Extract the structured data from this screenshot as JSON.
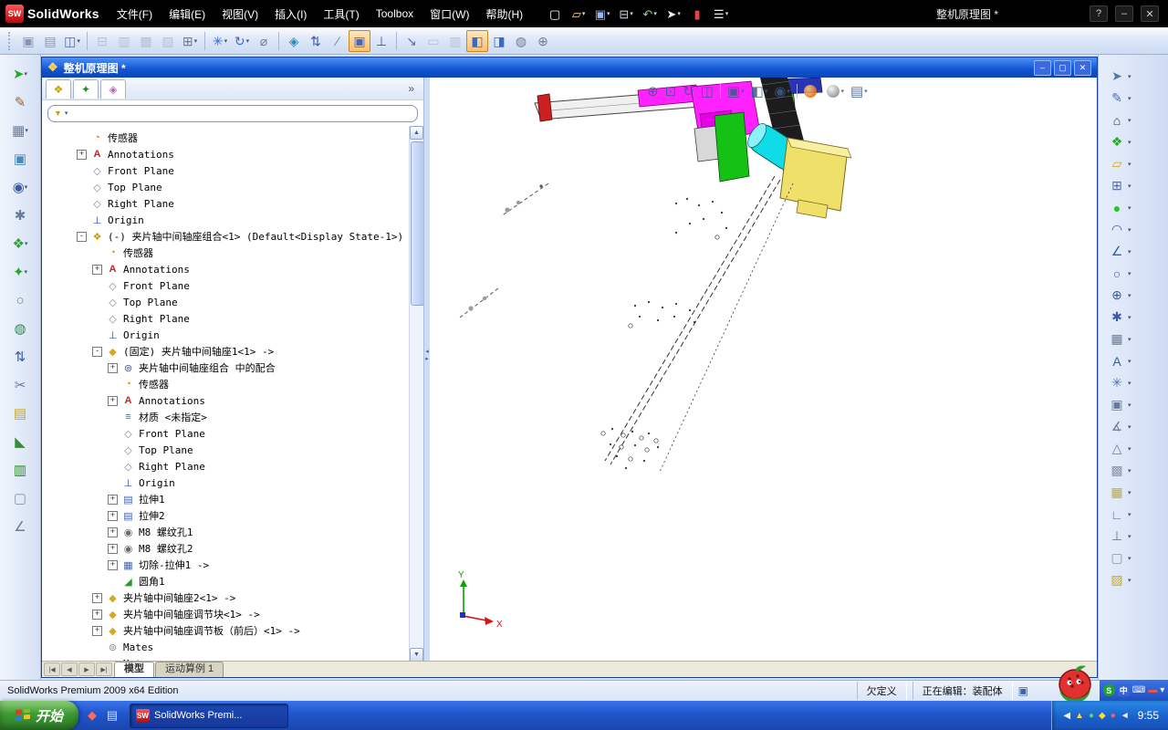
{
  "app": {
    "title": "整机原理图 *",
    "logo": "SolidWorks",
    "logo_badge": "SW",
    "window_controls": [
      "?",
      "–",
      "✕"
    ]
  },
  "menus": [
    "文件(F)",
    "编辑(E)",
    "视图(V)",
    "插入(I)",
    "工具(T)",
    "Toolbox",
    "窗口(W)",
    "帮助(H)"
  ],
  "menubar_icons": [
    {
      "name": "new-document-icon",
      "glyph": "▢",
      "color": "#f5f8ff"
    },
    {
      "name": "open-icon",
      "glyph": "▱",
      "color": "#ffd98a",
      "drop": true
    },
    {
      "name": "save-icon",
      "glyph": "▣",
      "color": "#9ab6ef",
      "drop": true
    },
    {
      "name": "print-icon",
      "glyph": "⊟",
      "color": "#cfd8ec",
      "drop": true
    },
    {
      "name": "undo-icon",
      "glyph": "↶",
      "color": "#8fd08f",
      "drop": true
    },
    {
      "name": "select-pointer-icon",
      "glyph": "➤",
      "color": "#e8edf8",
      "drop": true
    },
    {
      "name": "abort-rebuild-icon",
      "glyph": "▮",
      "color": "#e04444"
    },
    {
      "name": "options-icon",
      "glyph": "☰",
      "color": "#e8edf8",
      "drop": true
    }
  ],
  "toolbar2_groups": [
    [
      {
        "name": "paste-icon",
        "glyph": "▣",
        "color": "#8a94b8"
      },
      {
        "name": "copy-icon",
        "glyph": "▤",
        "color": "#8a94b8"
      },
      {
        "name": "new-window-icon",
        "glyph": "◫",
        "color": "#4a6ab8",
        "drop": true
      }
    ],
    [
      {
        "name": "print-preview-icon",
        "glyph": "⊟",
        "color": "#b8c0d4"
      },
      {
        "name": "table-grid-icon",
        "glyph": "▥",
        "color": "#b8c0d4"
      },
      {
        "name": "pattern-a-icon",
        "glyph": "▩",
        "color": "#b8c0d4"
      },
      {
        "name": "pattern-b-icon",
        "glyph": "▨",
        "color": "#b8c0d4"
      },
      {
        "name": "grid-settings-icon",
        "glyph": "⊞",
        "color": "#6a7a9a",
        "drop": true
      }
    ],
    [
      {
        "name": "smart-tool-icon",
        "glyph": "✳",
        "color": "#3a6ac8",
        "drop": true
      },
      {
        "name": "rebuild-icon",
        "glyph": "↻",
        "color": "#3a6ac8",
        "drop": true
      },
      {
        "name": "measure-icon",
        "glyph": "⌀",
        "color": "#6a7a9a"
      }
    ],
    [
      {
        "name": "view-cube-icon",
        "glyph": "◈",
        "color": "#2a8ab8"
      },
      {
        "name": "reorient-icon",
        "glyph": "⇅",
        "color": "#3a5aa8"
      },
      {
        "name": "trimetric-icon",
        "glyph": "∕",
        "color": "#6a7a9a"
      },
      {
        "name": "shaded-view-icon",
        "glyph": "▣",
        "color": "#3a6ac8",
        "pressed": true
      },
      {
        "name": "reference-axes-icon",
        "glyph": "⊥",
        "color": "#3a5aa8"
      }
    ],
    [
      {
        "name": "measure-distance-icon",
        "glyph": "↘",
        "color": "#5a74a8"
      },
      {
        "name": "mass-properties-icon",
        "glyph": "▭",
        "color": "#b8c0d4"
      },
      {
        "name": "section-properties-icon",
        "glyph": "▥",
        "color": "#b8c0d4"
      },
      {
        "name": "window-pane-left-icon",
        "glyph": "◧",
        "color": "#3a6ac8",
        "pressed": true
      },
      {
        "name": "window-pane-right-icon",
        "glyph": "◨",
        "color": "#3a6ac8"
      },
      {
        "name": "shaded-sphere-icon",
        "glyph": "◍",
        "color": "#6a7a9a"
      },
      {
        "name": "add-view-icon",
        "glyph": "⊕",
        "color": "#6a7a9a"
      }
    ]
  ],
  "left_toolbar": [
    {
      "name": "forward-arrow-icon",
      "glyph": "➤",
      "color": "#2aa82a",
      "drop": true
    },
    {
      "name": "pencil-icon",
      "glyph": "✎",
      "color": "#8a6a3a"
    },
    {
      "name": "grid-icon",
      "glyph": "▦",
      "color": "#6a7a9a",
      "drop": true
    },
    {
      "name": "image-icon",
      "glyph": "▣",
      "color": "#4a8ab8"
    },
    {
      "name": "eye-icon",
      "glyph": "◉",
      "color": "#3a5aa8",
      "drop": true
    },
    {
      "name": "gear-icon",
      "glyph": "✱",
      "color": "#6a7a9a"
    },
    {
      "name": "green-cube-icon",
      "glyph": "❖",
      "color": "#2aa82a",
      "drop": true
    },
    {
      "name": "spark-icon",
      "glyph": "✦",
      "color": "#2aa82a",
      "drop": true
    },
    {
      "name": "sphere-icon",
      "glyph": "○",
      "color": "#6a7a9a"
    },
    {
      "name": "globe-icon",
      "glyph": "◍",
      "color": "#2a8a5a"
    },
    {
      "name": "up-down-icon",
      "glyph": "⇅",
      "color": "#3a5aa8"
    },
    {
      "name": "scissors-icon",
      "glyph": "✂",
      "color": "#6a7a9a"
    },
    {
      "name": "gold-book-icon",
      "glyph": "▤",
      "color": "#c8a826"
    },
    {
      "name": "wedge-icon",
      "glyph": "◣",
      "color": "#3a8a3a"
    },
    {
      "name": "green-book-icon",
      "glyph": "▥",
      "color": "#2a8a2a"
    },
    {
      "name": "gray-box-icon",
      "glyph": "▢",
      "color": "#8a94a8"
    },
    {
      "name": "angle-icon",
      "glyph": "∠",
      "color": "#6a7a9a"
    }
  ],
  "right_toolbar": [
    {
      "name": "select-tool-icon",
      "glyph": "➤",
      "color": "#5a74a8",
      "drop": true
    },
    {
      "name": "sketch-tool-icon",
      "glyph": "✎",
      "color": "#4a6ab8",
      "drop": true
    },
    {
      "name": "home-view-icon",
      "glyph": "⌂",
      "color": "#333333",
      "drop": true
    },
    {
      "name": "parts-library-icon",
      "glyph": "❖",
      "color": "#1faa1f",
      "drop": true
    },
    {
      "name": "design-library-icon",
      "glyph": "▱",
      "color": "#d8a826",
      "drop": true
    },
    {
      "name": "file-explorer-icon",
      "glyph": "⊞",
      "color": "#4a6ab8",
      "drop": true
    },
    {
      "name": "appearance-sphere-icon",
      "glyph": "●",
      "color": "#22c822",
      "drop": true
    },
    {
      "name": "arc-tool-icon",
      "glyph": "◠",
      "color": "#3a5aa8",
      "drop": true
    },
    {
      "name": "angle-tool-icon",
      "glyph": "∠",
      "color": "#3a5aa8",
      "drop": true
    },
    {
      "name": "circle-tool-icon",
      "glyph": "○",
      "color": "#3a5aa8",
      "drop": true
    },
    {
      "name": "target-tool-icon",
      "glyph": "⊕",
      "color": "#3a5aa8",
      "drop": true
    },
    {
      "name": "star-tool-icon",
      "glyph": "✱",
      "color": "#3a5aa8",
      "drop": true
    },
    {
      "name": "pattern-tool-icon",
      "glyph": "▦",
      "color": "#6a7a9a",
      "drop": true
    },
    {
      "name": "text-tool-icon",
      "glyph": "A",
      "color": "#3a5aa8",
      "drop": true
    },
    {
      "name": "snowflake-tool-icon",
      "glyph": "✳",
      "color": "#5a74a8",
      "drop": true
    },
    {
      "name": "window-tool-icon",
      "glyph": "▣",
      "color": "#6a7a9a",
      "drop": true
    },
    {
      "name": "measure-angle-icon",
      "glyph": "∡",
      "color": "#6a7a9a",
      "drop": true
    },
    {
      "name": "triangle-tool-icon",
      "glyph": "△",
      "color": "#6a7a9a",
      "drop": true
    },
    {
      "name": "dot-grid-icon",
      "glyph": "▩",
      "color": "#8a94a8",
      "drop": true
    },
    {
      "name": "table-tool-icon",
      "glyph": "▦",
      "color": "#c8a826",
      "drop": true
    },
    {
      "name": "corner-tool-icon",
      "glyph": "∟",
      "color": "#6a7a9a",
      "drop": true
    },
    {
      "name": "perpendicular-tool-icon",
      "glyph": "⊥",
      "color": "#6a7a9a",
      "drop": true
    },
    {
      "name": "box-tool-icon",
      "glyph": "▢",
      "color": "#8a94a8",
      "drop": true
    },
    {
      "name": "hatch-tool-icon",
      "glyph": "▨",
      "color": "#c8a826",
      "drop": true
    }
  ],
  "doc": {
    "title": "整机原理图 *",
    "controls": [
      "–",
      "▢",
      "✕"
    ]
  },
  "panel": {
    "tabs": [
      {
        "name": "featuremanager-tab",
        "glyph": "❖",
        "color": "#c8a400"
      },
      {
        "name": "propertymanager-tab",
        "glyph": "✦",
        "color": "#2a8a2a"
      },
      {
        "name": "configurationmanager-tab",
        "glyph": "◈",
        "color": "#b06ab0"
      }
    ],
    "overflow_chevron": "»",
    "filter": {
      "funnel": "▼",
      "drop": "▾"
    }
  },
  "tree": [
    {
      "icon": "sensor",
      "label": "传感器",
      "level": 0
    },
    {
      "icon": "annotations",
      "label": "Annotations",
      "level": 0,
      "expand": "plus"
    },
    {
      "icon": "plane",
      "label": "Front Plane",
      "level": 0
    },
    {
      "icon": "plane",
      "label": "Top Plane",
      "level": 0
    },
    {
      "icon": "plane",
      "label": "Right Plane",
      "level": 0
    },
    {
      "icon": "origin",
      "label": "Origin",
      "level": 0
    },
    {
      "icon": "assembly",
      "label": "(-) 夹片轴中间轴座组合<1> (Default<Display State-1>)",
      "level": 0,
      "expand": "minus"
    },
    {
      "icon": "sensor",
      "label": "传感器",
      "level": 1
    },
    {
      "icon": "annotations",
      "label": "Annotations",
      "level": 1,
      "expand": "plus"
    },
    {
      "icon": "plane",
      "label": "Front Plane",
      "level": 1
    },
    {
      "icon": "plane",
      "label": "Top Plane",
      "level": 1
    },
    {
      "icon": "plane",
      "label": "Right Plane",
      "level": 1
    },
    {
      "icon": "origin",
      "label": "Origin",
      "level": 1
    },
    {
      "icon": "part",
      "label": "(固定) 夹片轴中间轴座1<1> ->",
      "level": 1,
      "expand": "minus"
    },
    {
      "icon": "mates-group",
      "label": "夹片轴中间轴座组合 中的配合",
      "level": 2,
      "expand": "plus"
    },
    {
      "icon": "sensor",
      "label": "传感器",
      "level": 2
    },
    {
      "icon": "annotations",
      "label": "Annotations",
      "level": 2,
      "expand": "plus"
    },
    {
      "icon": "material",
      "label": "材质 <未指定>",
      "level": 2
    },
    {
      "icon": "plane",
      "label": "Front Plane",
      "level": 2
    },
    {
      "icon": "plane",
      "label": "Top Plane",
      "level": 2
    },
    {
      "icon": "plane",
      "label": "Right Plane",
      "level": 2
    },
    {
      "icon": "origin",
      "label": "Origin",
      "level": 2
    },
    {
      "icon": "extrude",
      "label": "拉伸1",
      "level": 2,
      "expand": "plus"
    },
    {
      "icon": "extrude",
      "label": "拉伸2",
      "level": 2,
      "expand": "plus"
    },
    {
      "icon": "hole",
      "label": "M8 螺纹孔1",
      "level": 2,
      "expand": "plus"
    },
    {
      "icon": "hole",
      "label": "M8 螺纹孔2",
      "level": 2,
      "expand": "plus"
    },
    {
      "icon": "cut",
      "label": "切除-拉伸1 ->",
      "level": 2,
      "expand": "plus"
    },
    {
      "icon": "fillet",
      "label": "圆角1",
      "level": 2
    },
    {
      "icon": "part",
      "label": "夹片轴中间轴座2<1> ->",
      "level": 1,
      "expand": "plus"
    },
    {
      "icon": "part",
      "label": "夹片轴中间轴座调节块<1> ->",
      "level": 1,
      "expand": "plus"
    },
    {
      "icon": "part",
      "label": "夹片轴中间轴座调节板（前后）<1> ->",
      "level": 1,
      "expand": "plus"
    },
    {
      "icon": "mates",
      "label": "Mates",
      "level": 1
    },
    {
      "icon": "motor",
      "label": "Motor",
      "level": 1
    }
  ],
  "headsup": [
    {
      "name": "zoom-to-fit-icon",
      "glyph": "⊕"
    },
    {
      "name": "zoom-to-area-icon",
      "glyph": "⊡"
    },
    {
      "name": "previous-view-icon",
      "glyph": "↻"
    },
    {
      "name": "section-view-icon",
      "glyph": "◫"
    },
    {
      "sep": true
    },
    {
      "name": "view-orientation-icon",
      "glyph": "▣",
      "drop": true
    },
    {
      "name": "display-style-icon",
      "glyph": "◧",
      "drop": true
    },
    {
      "name": "hide-show-items-icon",
      "glyph": "◉",
      "drop": true
    },
    {
      "sep": true
    },
    {
      "name": "edit-appearance-icon",
      "ball": "orange",
      "drop": true
    },
    {
      "name": "apply-scene-icon",
      "ball": "gray",
      "drop": true
    },
    {
      "name": "view-settings-icon",
      "glyph": "▤",
      "drop": true
    }
  ],
  "bottom_tabs": {
    "nav": [
      "|◀",
      "◀",
      "▶",
      "▶|"
    ],
    "tabs": [
      {
        "label": "模型",
        "active": true
      },
      {
        "label": "运动算例 1",
        "active": false
      }
    ]
  },
  "status_bar": {
    "left": "SolidWorks Premium 2009 x64 Edition",
    "define_state": "欠定义",
    "editing": "正在编辑：装配体"
  },
  "language_bar": [
    {
      "name": "ime-language-icon",
      "glyph": "S",
      "bg": "#1fa32a",
      "color": "#ffffff",
      "round": true
    },
    {
      "name": "ime-chinese-icon",
      "glyph": "中",
      "bg": "#3a62d8",
      "color": "#ffffff"
    },
    {
      "name": "ime-keyboard-icon",
      "glyph": "⌨",
      "color": "#eaf0ff"
    },
    {
      "name": "ime-band-icon",
      "glyph": "▬",
      "color": "#e05a4a"
    },
    {
      "name": "ime-options-icon",
      "glyph": "▾",
      "color": "#eaf0ff"
    }
  ],
  "taskbar": {
    "start_label": "开始",
    "quick_launch": [
      {
        "name": "quick-solidworks-icon",
        "glyph": "◆",
        "color": "#ff6a5a"
      },
      {
        "name": "quick-desktop-icon",
        "glyph": "▤",
        "color": "#cfe0ff"
      }
    ],
    "task": {
      "label": "SolidWorks Premi...",
      "badge": "SW"
    },
    "tray_icons": [
      {
        "name": "tray-hide-chevron-icon",
        "glyph": "◀",
        "color": "#eaf2ff"
      },
      {
        "name": "tray-shield-icon",
        "glyph": "▲",
        "color": "#ffd24a"
      },
      {
        "name": "tray-green-icon",
        "glyph": "●",
        "color": "#58d858"
      },
      {
        "name": "tray-update-icon",
        "glyph": "◆",
        "color": "#ffda3a"
      },
      {
        "name": "tray-alert-icon",
        "glyph": "●",
        "color": "#ff5a5a"
      },
      {
        "name": "tray-volume-icon",
        "glyph": "◄",
        "color": "#eaf2ff"
      }
    ],
    "time": "9:55"
  },
  "viewport": {
    "triad_x": "X",
    "triad_y": "Y"
  },
  "scrollbar": {
    "up": "▲",
    "down": "▼"
  },
  "splitter": {
    "left": "◂",
    "right": "▸"
  }
}
